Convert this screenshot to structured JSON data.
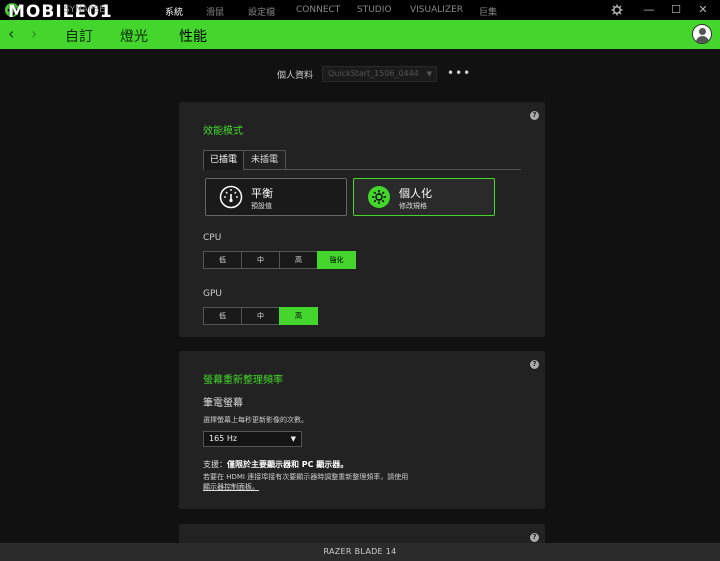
{
  "watermark": "MOBILE01",
  "topnav": {
    "items": [
      {
        "label": "SYNAPSE"
      },
      {
        "label": "系統"
      },
      {
        "label": "滑鼠"
      },
      {
        "label": "設定檔"
      },
      {
        "label": "CONNECT"
      },
      {
        "label": "STUDIO"
      },
      {
        "label": "VISUALIZER"
      },
      {
        "label": "巨集"
      }
    ],
    "active_index": 1
  },
  "window": {
    "settings_icon": "gear-icon",
    "minimize": "—",
    "maximize": "☐",
    "close": "✕"
  },
  "subnav": {
    "back": "‹",
    "forward": "›",
    "tabs": [
      {
        "label": "自訂"
      },
      {
        "label": "燈光"
      },
      {
        "label": "性能"
      }
    ],
    "active_index": 2
  },
  "profile": {
    "label": "個人資料",
    "value": "QuickStart_1506_0444",
    "caret": "▼",
    "more": "•••"
  },
  "performance": {
    "help": "?",
    "title": "效能模式",
    "power_tabs": [
      {
        "label": "已插電"
      },
      {
        "label": "未插電"
      }
    ],
    "modes": [
      {
        "name": "平衡",
        "sub": "預設值",
        "icon": "gauge-icon",
        "selected": false
      },
      {
        "name": "個人化",
        "sub": "修改規格",
        "icon": "gear-icon",
        "selected": true
      }
    ],
    "cpu": {
      "label": "CPU",
      "options": [
        "低",
        "中",
        "高",
        "強化"
      ],
      "selected": 3
    },
    "gpu": {
      "label": "GPU",
      "options": [
        "低",
        "中",
        "高"
      ],
      "selected": 2
    }
  },
  "refresh": {
    "help": "?",
    "title": "螢幕重新整理頻率",
    "display_label": "筆電螢幕",
    "description": "選擇螢幕上每秒更新影像的次數。",
    "rate": "165 Hz",
    "caret": "▼",
    "support_prefix": "支援：",
    "support_bold": "僅限於主要顯示器和 PC 顯示器。",
    "note": "若要在 HDMI 連接埠接有次要顯示器時調整重新整理頻率，請使用",
    "note_link": "顯示器控制面板。"
  },
  "third_card": {
    "help": "?"
  },
  "status": {
    "device": "RAZER BLADE 14"
  },
  "colors": {
    "accent": "#44d62c",
    "background": "#111111",
    "card": "#222222"
  }
}
